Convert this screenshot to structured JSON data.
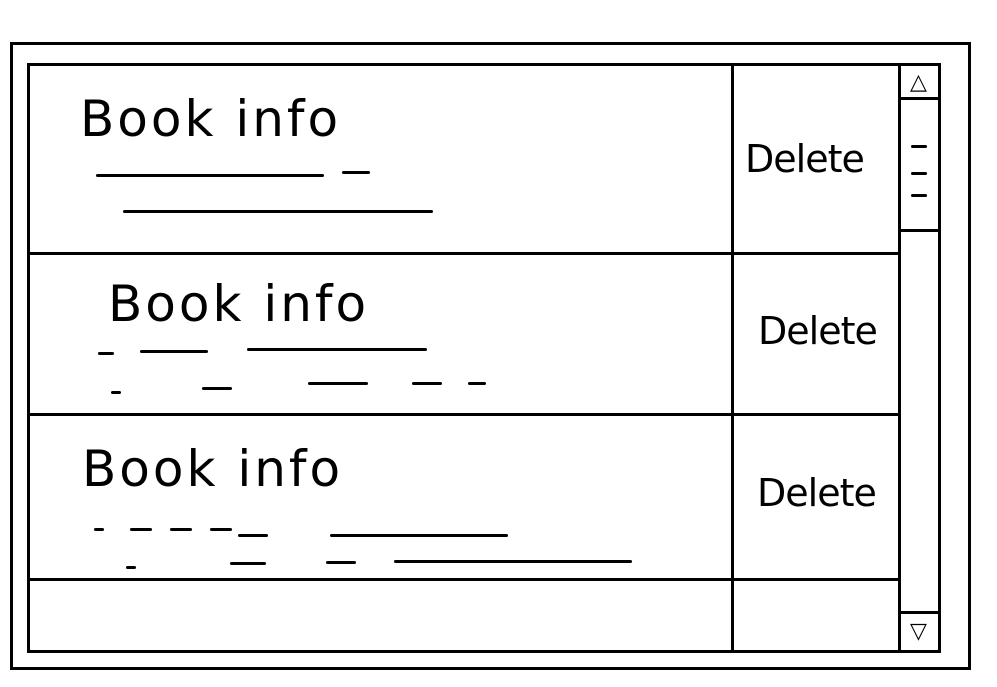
{
  "rows": [
    {
      "title": "Book info",
      "delete_label": "Delete"
    },
    {
      "title": "Book info",
      "delete_label": "Delete"
    },
    {
      "title": "Book info",
      "delete_label": "Delete"
    }
  ],
  "scrollbar": {
    "up_icon": "triangle-up-icon",
    "down_icon": "triangle-down-icon",
    "up_glyph": "△",
    "down_glyph": "▽"
  },
  "colors": {
    "stroke": "#000000",
    "background": "#ffffff"
  }
}
